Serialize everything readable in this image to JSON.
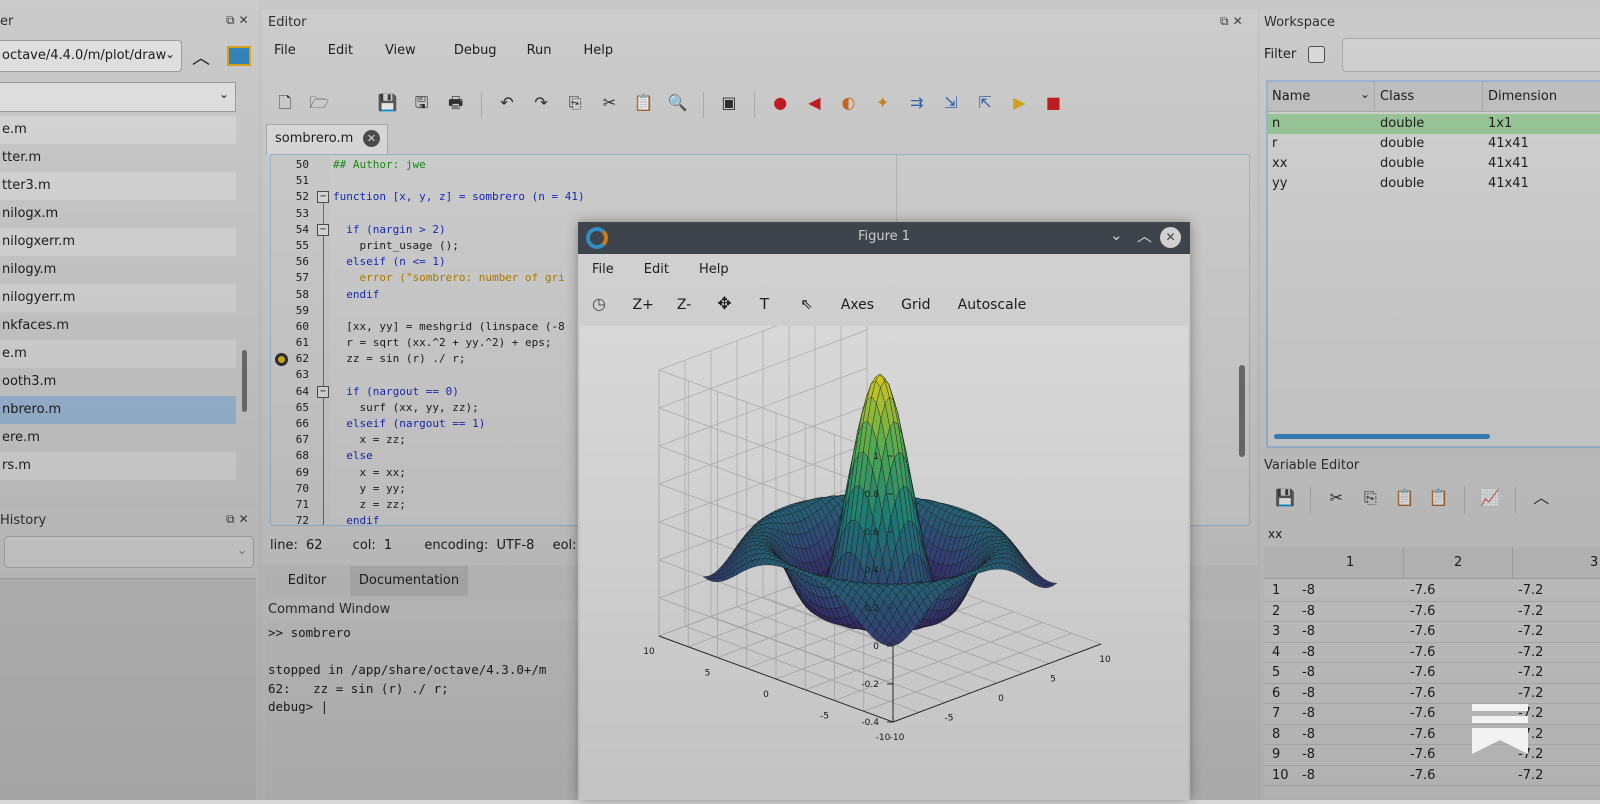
{
  "file_browser": {
    "title": "er",
    "path": "octave/4.4.0/m/plot/draw",
    "items": [
      {
        "label": "e.m",
        "style": "alt"
      },
      {
        "label": "tter.m",
        "style": ""
      },
      {
        "label": "tter3.m",
        "style": "alt"
      },
      {
        "label": "nilogx.m",
        "style": ""
      },
      {
        "label": "nilogxerr.m",
        "style": "alt"
      },
      {
        "label": "nilogy.m",
        "style": ""
      },
      {
        "label": "nilogyerr.m",
        "style": "alt"
      },
      {
        "label": "nkfaces.m",
        "style": ""
      },
      {
        "label": "e.m",
        "style": "alt"
      },
      {
        "label": "ooth3.m",
        "style": ""
      },
      {
        "label": "nbrero.m",
        "style": "sel"
      },
      {
        "label": "ere.m",
        "style": ""
      },
      {
        "label": "rs.m",
        "style": "alt"
      }
    ]
  },
  "history": {
    "title": "History"
  },
  "editor": {
    "title": "Editor",
    "menu": [
      "File",
      "Edit",
      "View",
      "Debug",
      "Run",
      "Help"
    ],
    "tab": "sombrero.m",
    "status": {
      "line_label": "line:",
      "line": "62",
      "col_label": "col:",
      "col": "1",
      "enc_label": "encoding:",
      "enc": "UTF-8",
      "eol_label": "eol:"
    },
    "bottom_tabs": [
      "Editor",
      "Documentation"
    ],
    "code": [
      {
        "n": "50",
        "t": "## Author: jwe",
        "c": "cm"
      },
      {
        "n": "51",
        "t": "",
        "c": ""
      },
      {
        "n": "52",
        "t": "function [x, y, z] = sombrero (n = 41)",
        "c": "kw"
      },
      {
        "n": "53",
        "t": "",
        "c": ""
      },
      {
        "n": "54",
        "t": "  if (nargin > 2)",
        "c": "kw"
      },
      {
        "n": "55",
        "t": "    print_usage ();",
        "c": ""
      },
      {
        "n": "56",
        "t": "  elseif (n <= 1)",
        "c": "kw"
      },
      {
        "n": "57",
        "t": "    error (\"sombrero: number of gri",
        "c": "str"
      },
      {
        "n": "58",
        "t": "  endif",
        "c": "kw"
      },
      {
        "n": "59",
        "t": "",
        "c": ""
      },
      {
        "n": "60",
        "t": "  [xx, yy] = meshgrid (linspace (-8",
        "c": ""
      },
      {
        "n": "61",
        "t": "  r = sqrt (xx.^2 + yy.^2) + eps;",
        "c": ""
      },
      {
        "n": "62",
        "t": "  zz = sin (r) ./ r;",
        "c": ""
      },
      {
        "n": "63",
        "t": "",
        "c": ""
      },
      {
        "n": "64",
        "t": "  if (nargout == 0)",
        "c": "kw"
      },
      {
        "n": "65",
        "t": "    surf (xx, yy, zz);",
        "c": ""
      },
      {
        "n": "66",
        "t": "  elseif (nargout == 1)",
        "c": "kw"
      },
      {
        "n": "67",
        "t": "    x = zz;",
        "c": ""
      },
      {
        "n": "68",
        "t": "  else",
        "c": "kw"
      },
      {
        "n": "69",
        "t": "    x = xx;",
        "c": ""
      },
      {
        "n": "70",
        "t": "    y = yy;",
        "c": ""
      },
      {
        "n": "71",
        "t": "    z = zz;",
        "c": ""
      },
      {
        "n": "72",
        "t": "  endif",
        "c": "kw"
      }
    ]
  },
  "command_window": {
    "title": "Command Window",
    "lines": [
      "&gt;&gt; sombrero",
      "",
      "stopped in /app/share/octave/4.3.0+/m",
      "62:   zz = sin (r) ./ r;",
      "debug&gt; |"
    ]
  },
  "workspace": {
    "title": "Workspace",
    "filter_label": "Filter",
    "columns": [
      "Name",
      "Class",
      "Dimension"
    ],
    "rows": [
      {
        "name": "n",
        "class": "double",
        "dim": "1x1"
      },
      {
        "name": "r",
        "class": "double",
        "dim": "41x41"
      },
      {
        "name": "xx",
        "class": "double",
        "dim": "41x41"
      },
      {
        "name": "yy",
        "class": "double",
        "dim": "41x41"
      }
    ]
  },
  "variable_editor": {
    "title": "Variable Editor",
    "var": "xx",
    "columns": [
      "1",
      "2",
      "3"
    ],
    "rows": [
      {
        "i": "1",
        "a": "-8",
        "b": "-7.6",
        "c": "-7.2"
      },
      {
        "i": "2",
        "a": "-8",
        "b": "-7.6",
        "c": "-7.2"
      },
      {
        "i": "3",
        "a": "-8",
        "b": "-7.6",
        "c": "-7.2"
      },
      {
        "i": "4",
        "a": "-8",
        "b": "-7.6",
        "c": "-7.2"
      },
      {
        "i": "5",
        "a": "-8",
        "b": "-7.6",
        "c": "-7.2"
      },
      {
        "i": "6",
        "a": "-8",
        "b": "-7.6",
        "c": "-7.2"
      },
      {
        "i": "7",
        "a": "-8",
        "b": "-7.6",
        "c": "-7.2"
      },
      {
        "i": "8",
        "a": "-8",
        "b": "-7.6",
        "c": "-7.2"
      },
      {
        "i": "9",
        "a": "-8",
        "b": "-7.6",
        "c": "-7.2"
      },
      {
        "i": "10",
        "a": "-8",
        "b": "-7.6",
        "c": "-7.2"
      }
    ]
  },
  "figure": {
    "title": "Figure 1",
    "menu": [
      "File",
      "Edit",
      "Help"
    ],
    "toolbar": [
      "Z+",
      "Z-",
      "Axes",
      "Grid",
      "Autoscale"
    ],
    "z_ticks": [
      "1",
      "0.8",
      "0.6",
      "0.4",
      "0.2",
      "0",
      "-0.2",
      "-0.4"
    ],
    "y_ticks": [
      "10",
      "5",
      "0",
      "-5",
      "-10"
    ],
    "x_ticks": [
      "-10",
      "-5",
      "0",
      "5",
      "10"
    ]
  }
}
